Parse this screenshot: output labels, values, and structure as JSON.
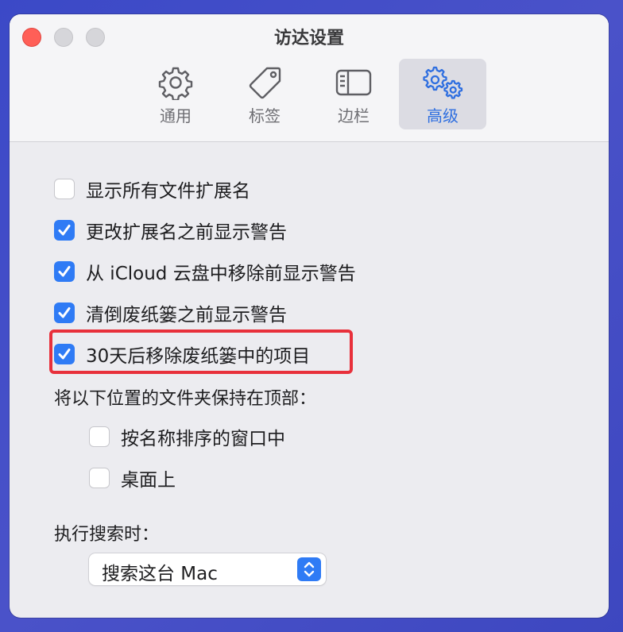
{
  "window": {
    "title": "访达设置"
  },
  "toolbar": {
    "tabs": [
      {
        "label": "通用",
        "icon": "gear-icon",
        "active": false
      },
      {
        "label": "标签",
        "icon": "tag-icon",
        "active": false
      },
      {
        "label": "边栏",
        "icon": "sidebar-icon",
        "active": false
      },
      {
        "label": "高级",
        "icon": "gears-icon",
        "active": true
      }
    ]
  },
  "settings": {
    "options": [
      {
        "label": "显示所有文件扩展名",
        "checked": false
      },
      {
        "label": "更改扩展名之前显示警告",
        "checked": true
      },
      {
        "label": "从 iCloud 云盘中移除前显示警告",
        "checked": true
      },
      {
        "label": "清倒废纸篓之前显示警告",
        "checked": true
      },
      {
        "label": "30天后移除废纸篓中的项目",
        "checked": true
      }
    ],
    "folders_heading": "将以下位置的文件夹保持在顶部：",
    "folder_options": [
      {
        "label": "按名称排序的窗口中",
        "checked": false
      },
      {
        "label": "桌面上",
        "checked": false
      }
    ],
    "search_heading": "执行搜索时：",
    "search_scope": {
      "value": "搜索这台 Mac"
    }
  },
  "colors": {
    "accent": "#2f7bf5",
    "highlight_box": "#e8303b",
    "close_button": "#ff5f57"
  }
}
